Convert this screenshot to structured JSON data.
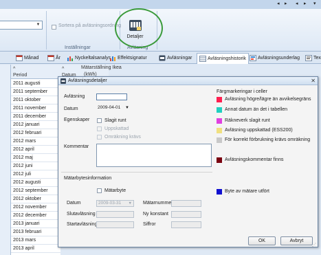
{
  "ribbon": {
    "sort_label": "Sortera på avläsningsordning",
    "group_settings": "Inställningar",
    "group_reading": "Avläsning",
    "details_button": "Detaljer"
  },
  "tabs": [
    {
      "label": "Månad"
    },
    {
      "label": "År"
    },
    {
      "label": "Nyckeltalsanalys"
    },
    {
      "label": "Effektsignatur"
    },
    {
      "label": "Avläsningar"
    },
    {
      "label": "Avläsningshistorik"
    },
    {
      "label": "Avläsningsunderlag"
    },
    {
      "label": "Tex"
    }
  ],
  "grid": {
    "header_period": "Period",
    "header_datum": "Datum",
    "header_meter": "Mätarställning Ikea",
    "header_kwh": "(kWh)",
    "rows": [
      "2011 augusti",
      "2011 september",
      "2011 oktober",
      "2011 november",
      "2011 december",
      "2012 januari",
      "2012 februari",
      "2012 mars",
      "2012 april",
      "2012 maj",
      "2012 juni",
      "2012 juli",
      "2012 augusti",
      "2012 september",
      "2012 oktober",
      "2012 november",
      "2012 december",
      "2013 januari",
      "2013 februari",
      "2013 mars",
      "2013 april"
    ]
  },
  "dialog": {
    "title": "Avläsningsdetaljer",
    "avlasning_label": "Avläsning",
    "avlasning_value": "",
    "datum_label": "Datum",
    "datum_value": "2009-04-01",
    "egenskaper_label": "Egenskaper",
    "slagit_runt": "Slagit runt",
    "uppskattad": "Uppskattad",
    "omrakning": "Omräkning krävs",
    "kommentar_label": "Kommentar",
    "matarbyte_header": "Mätarbytesinformation",
    "matarbyte_cb": "Mätarbyte",
    "mb_datum_label": "Datum",
    "mb_datum_value": "2009-03-31",
    "slutavlasning_label": "Slutavläsning",
    "startavlasning_label": "Startavläsning",
    "matarnummer_label": "Mätarnummer",
    "ny_konstant_label": "Ny konstant",
    "siffror_label": "Siffror",
    "legend_title": "Färgmarkeringar i celler",
    "legend": [
      {
        "label": "Avläsning högre/lägre än avvikelsegräns",
        "color": "#ff1f4f"
      },
      {
        "label": "Annat datum än det i tabellen",
        "color": "#20d0c0"
      },
      {
        "label": "Räkneverk slagit runt",
        "color": "#e040e0"
      },
      {
        "label": "Avläsning uppskattad (ESS200)",
        "color": "#f0e080"
      },
      {
        "label": "För korrekt förbrukning krävs omräkning",
        "color": "#c8c8c8"
      },
      {
        "label": "Avläsningskommentar finns",
        "color": "#7a0010"
      },
      {
        "label": "Byte av mätare utfört",
        "color": "#1010d0"
      }
    ],
    "ok": "OK",
    "cancel": "Avbryt"
  }
}
